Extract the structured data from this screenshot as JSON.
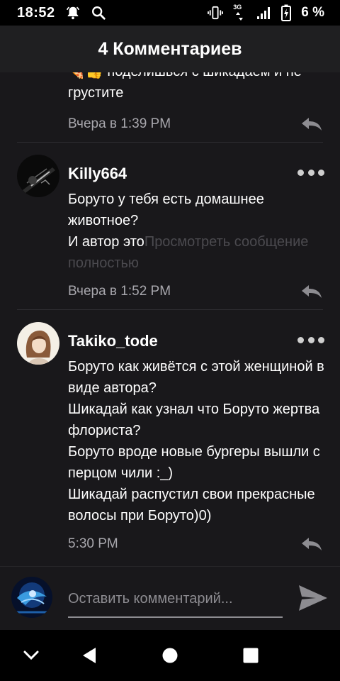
{
  "status_bar": {
    "time": "18:52",
    "left_icons": [
      "notification-bell-icon",
      "search-icon"
    ],
    "right_icons": [
      "vibrate-icon",
      "network-3g-icon",
      "signal-icon",
      "battery-charging-icon"
    ],
    "network_label": "3G",
    "battery": "6 %"
  },
  "header": {
    "title": "4 Комментариев"
  },
  "comments": [
    {
      "author": "",
      "text": "🍕👍 поделишься с шикадаем и не грустите",
      "time": "Вчера в 1:39 PM"
    },
    {
      "author": "Killy664",
      "text": "Боруто у тебя есть домашнее животное?\nИ автор это",
      "more_link": "Просмотреть сообщение полностью",
      "time": "Вчера в 1:52 PM"
    },
    {
      "author": "Takiko_tode",
      "text": "Боруто как живётся с этой женщиной в виде автора?\nШикадай как узнал что Боруто жертва флориста?\nБоруто вроде новые бургеры вышли с перцом чили :_)\nШикадай распустил свои прекрасные волосы при Боруто)0)",
      "time": "5:30 PM"
    }
  ],
  "composer": {
    "placeholder": "Оставить комментарий...",
    "value": ""
  },
  "nav": [
    "chevron-down-icon",
    "back-icon",
    "home-icon",
    "recents-icon"
  ],
  "colors": {
    "background": "#19181b",
    "header": "#1f1f21",
    "timestamp": "#a8a7ad",
    "muted_link": "#4b4a4f"
  }
}
